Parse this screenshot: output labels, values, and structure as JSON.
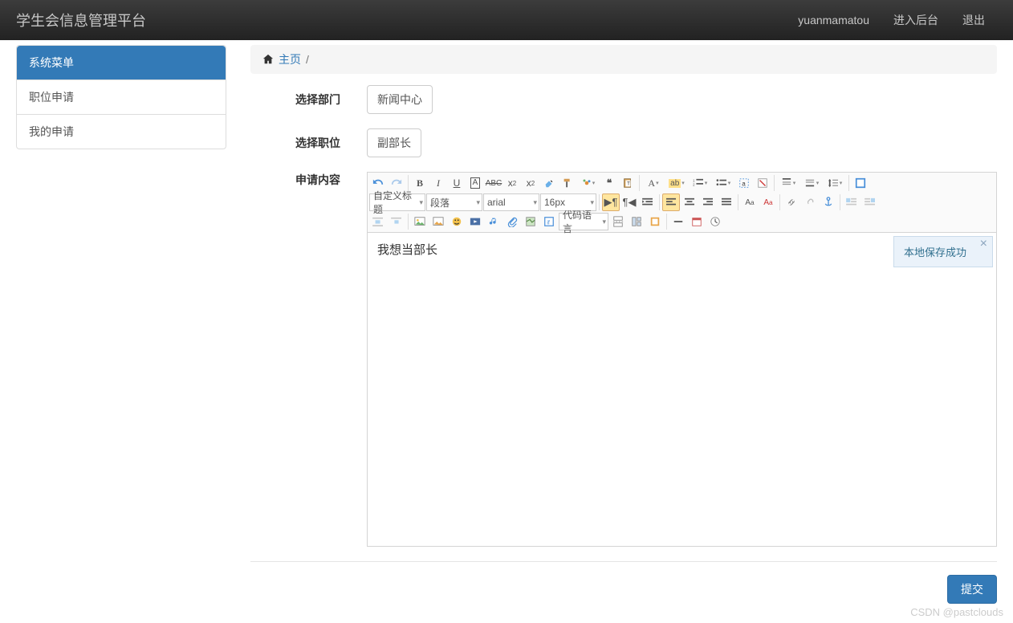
{
  "navbar": {
    "brand": "学生会信息管理平台",
    "user": "yuanmamatou",
    "admin": "进入后台",
    "logout": "退出"
  },
  "sidebar": {
    "header": "系统菜单",
    "items": [
      "职位申请",
      "我的申请"
    ]
  },
  "breadcrumb": {
    "home": "主页",
    "sep": "/"
  },
  "form": {
    "dept_label": "选择部门",
    "dept_value": "新闻中心",
    "pos_label": "选择职位",
    "pos_value": "副部长",
    "content_label": "申请内容",
    "content_text": "我想当部长",
    "submit": "提交"
  },
  "editor_selects": {
    "heading": "自定义标题",
    "paragraph": "段落",
    "font": "arial",
    "size": "16px",
    "codelang": "代码语言"
  },
  "toast": {
    "msg": "本地保存成功",
    "close": "×"
  },
  "watermark": "CSDN @pastclouds"
}
